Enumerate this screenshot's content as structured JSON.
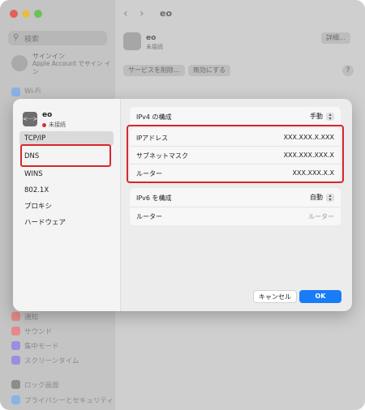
{
  "window": {
    "nav_title": "eo",
    "search_placeholder": "検索",
    "signin_title": "サインイン",
    "signin_subtitle": "Apple Account でサイン イン"
  },
  "bg_sidebar": {
    "items_top": [
      {
        "label": "Wi-Fi",
        "color": "#8ab2e8"
      }
    ],
    "items_bottom": [
      {
        "label": "通知",
        "color": "#e68a8a"
      },
      {
        "label": "サウンド",
        "color": "#e68a8a"
      },
      {
        "label": "集中モード",
        "color": "#9a8ee0"
      },
      {
        "label": "スクリーンタイム",
        "color": "#9a8ee0"
      },
      {
        "label": "ロック画面",
        "color": "#8c8c8c"
      },
      {
        "label": "プライバシーとセキュリティ",
        "color": "#8ab2e8"
      }
    ]
  },
  "bg_main": {
    "service_name": "eo",
    "service_status": "未接続",
    "details_button": "詳細...",
    "remove_service_button": "サービスを削除...",
    "disable_button": "無効にする",
    "help": "?"
  },
  "sheet": {
    "service_name": "eo",
    "service_status": "未接続",
    "service_icon": "<···>",
    "tabs": [
      "TCP/IP",
      "DNS",
      "WINS",
      "802.1X",
      "プロキシ",
      "ハードウェア"
    ],
    "selected_tab": "TCP/IP",
    "ipv4": {
      "label": "IPv4 の構成",
      "value": "手動"
    },
    "ipv4_fields": [
      {
        "label": "IPアドレス",
        "value": "XXX.XXX.X.XXX"
      },
      {
        "label": "サブネットマスク",
        "value": "XXX.XXX.XXX.X"
      },
      {
        "label": "ルーター",
        "value": "XXX.XXX.X.X"
      }
    ],
    "ipv6": {
      "label": "IPv6 を構成",
      "value": "自動"
    },
    "ipv6_router": {
      "label": "ルーター",
      "value": "ルーター"
    },
    "cancel_button": "キャンセル",
    "ok_button": "OK"
  },
  "colors": {
    "highlight": "#d9262b",
    "accent": "#1a7cf6",
    "status_dot": "#d9302b"
  }
}
